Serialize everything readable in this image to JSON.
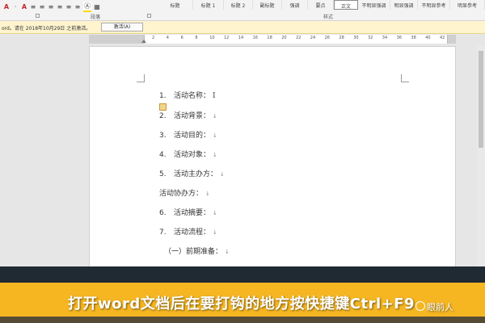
{
  "ribbon": {
    "tools": [
      "A",
      "·",
      "A",
      "≡",
      "≡",
      "≡",
      "≡",
      "≡",
      "≡",
      "Ⓐ",
      "▦"
    ],
    "group_paragraph": "段落",
    "group_styles": "样式",
    "styles": [
      "标题",
      "标题 1",
      "标题 2",
      "副标题",
      "强调",
      "要点",
      "正文",
      "不明显强调",
      "明显强调",
      "不明显参考",
      "明显参考"
    ]
  },
  "message_bar": {
    "text": "ord。请在 2018年10月29日 之前激活。",
    "button_label": "激活(A)"
  },
  "ruler": {
    "numbers": [
      "2",
      "4",
      "6",
      "8",
      "10",
      "12",
      "14",
      "16",
      "18",
      "20",
      "22",
      "24",
      "26",
      "28",
      "30",
      "32",
      "34",
      "36",
      "38",
      "40",
      "42"
    ]
  },
  "document": {
    "paragraph_mark": "↓",
    "cursor_glyph": "I",
    "lines": [
      {
        "num": "1.",
        "text": "活动名称："
      },
      {
        "num": "2.",
        "text": "活动背景："
      },
      {
        "num": "3.",
        "text": "活动目的："
      },
      {
        "num": "4.",
        "text": "活动对象："
      },
      {
        "num": "5.",
        "text": "活动主办方："
      },
      {
        "num": "",
        "text": "活动协办方："
      },
      {
        "num": "6.",
        "text": "活动摘要："
      },
      {
        "num": "7.",
        "text": "活动流程："
      },
      {
        "num": "",
        "text": "（一）前期准备："
      }
    ]
  },
  "caption": {
    "text": "打开word文档后在要打钩的地方按快捷键Ctrl+F9",
    "watermark": "眼前人"
  },
  "colors": {
    "caption_band": "#f5b622",
    "message_bar": "#fff4ce"
  }
}
